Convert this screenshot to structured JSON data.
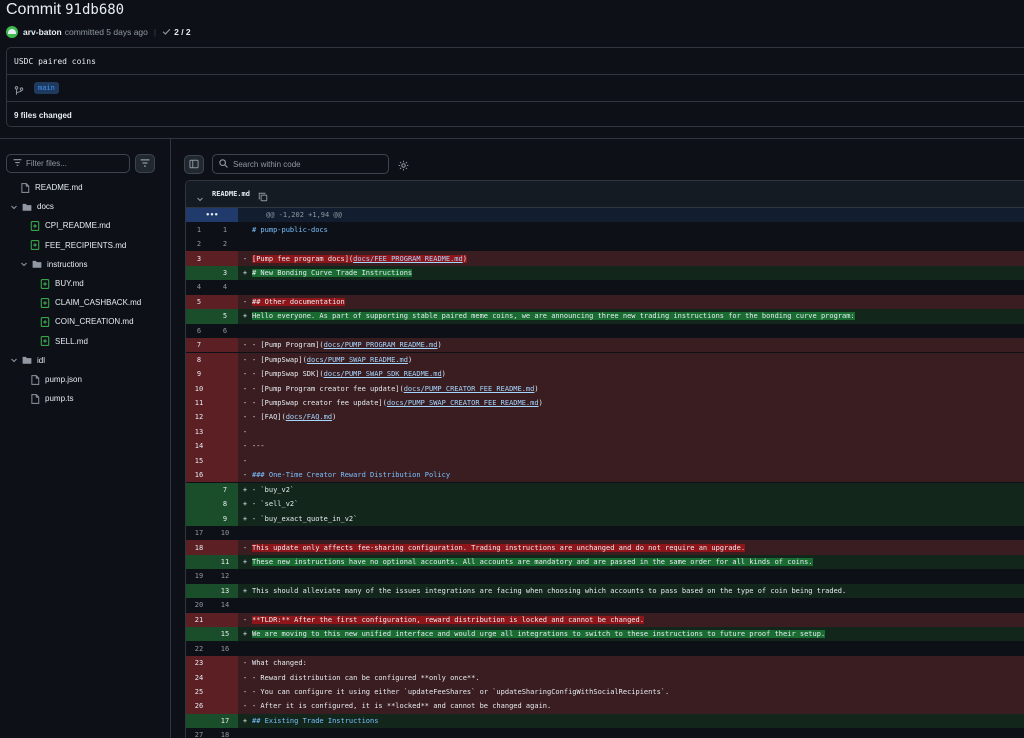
{
  "header": {
    "title_prefix": "Commit",
    "sha": "91db680",
    "author": "arv-baton",
    "committed_text": "committed 5 days ago",
    "checks": "2 / 2"
  },
  "commit": {
    "message": "USDC paired coins",
    "branch": "main",
    "files_changed": "9 files changed"
  },
  "filter": {
    "placeholder": "Filter files..."
  },
  "code_search": {
    "placeholder": "Search within code"
  },
  "tree": [
    {
      "label": "README.md",
      "type": "file",
      "depth": 0,
      "changed": false
    },
    {
      "label": "docs",
      "type": "folder",
      "depth": 0
    },
    {
      "label": "CPI_README.md",
      "type": "file",
      "depth": 1,
      "changed": true
    },
    {
      "label": "FEE_RECIPIENTS.md",
      "type": "file",
      "depth": 1,
      "changed": true
    },
    {
      "label": "instructions",
      "type": "folder",
      "depth": 1
    },
    {
      "label": "BUY.md",
      "type": "file",
      "depth": 2,
      "changed": true
    },
    {
      "label": "CLAIM_CASHBACK.md",
      "type": "file",
      "depth": 2,
      "changed": true
    },
    {
      "label": "COIN_CREATION.md",
      "type": "file",
      "depth": 2,
      "changed": true
    },
    {
      "label": "SELL.md",
      "type": "file",
      "depth": 2,
      "changed": true
    },
    {
      "label": "idl",
      "type": "folder",
      "depth": 0
    },
    {
      "label": "pump.json",
      "type": "file",
      "depth": 1,
      "changed": false
    },
    {
      "label": "pump.ts",
      "type": "file",
      "depth": 1,
      "changed": false
    }
  ],
  "diff": {
    "filename": "README.md",
    "hunk_expand": "•••",
    "lines": [
      {
        "t": "hunk",
        "o": "",
        "n": "",
        "text": "@@ -1,202 +1,94 @@"
      },
      {
        "t": "ctx",
        "o": "1",
        "n": "1",
        "text": "# pump-public-docs",
        "blue": true
      },
      {
        "t": "ctx",
        "o": "2",
        "n": "2",
        "text": ""
      },
      {
        "t": "del",
        "o": "3",
        "n": "",
        "text": "[Pump fee program docs](docs/FEE_PROGRAM_README.md)",
        "mark": true
      },
      {
        "t": "add",
        "o": "",
        "n": "3",
        "text": "# New Bonding Curve Trade Instructions",
        "mark": true
      },
      {
        "t": "ctx",
        "o": "4",
        "n": "4",
        "text": ""
      },
      {
        "t": "del",
        "o": "5",
        "n": "",
        "text": "## Other documentation",
        "mark": true
      },
      {
        "t": "add",
        "o": "",
        "n": "5",
        "text": "Hello everyone. As part of supporting stable paired meme coins, we are announcing three new trading instructions for the bonding curve program:",
        "mark": true
      },
      {
        "t": "ctx",
        "o": "6",
        "n": "6",
        "text": ""
      },
      {
        "t": "del",
        "o": "7",
        "n": "",
        "text": "- [Pump Program](docs/PUMP_PROGRAM_README.md)"
      },
      {
        "t": "del",
        "o": "8",
        "n": "",
        "text": "- [PumpSwap](docs/PUMP_SWAP_README.md)"
      },
      {
        "t": "del",
        "o": "9",
        "n": "",
        "text": "- [PumpSwap SDK](docs/PUMP_SWAP_SDK_README.md)"
      },
      {
        "t": "del",
        "o": "10",
        "n": "",
        "text": "- [Pump Program creator fee update](docs/PUMP_CREATOR_FEE_README.md)"
      },
      {
        "t": "del",
        "o": "11",
        "n": "",
        "text": "- [PumpSwap creator fee update](docs/PUMP_SWAP_CREATOR_FEE_README.md)"
      },
      {
        "t": "del",
        "o": "12",
        "n": "",
        "text": "- [FAQ](docs/FAQ.md)"
      },
      {
        "t": "del",
        "o": "13",
        "n": "",
        "text": ""
      },
      {
        "t": "del",
        "o": "14",
        "n": "",
        "text": "---"
      },
      {
        "t": "del",
        "o": "15",
        "n": "",
        "text": ""
      },
      {
        "t": "del",
        "o": "16",
        "n": "",
        "text": "### One-Time Creator Reward Distribution Policy",
        "blue": true
      },
      {
        "t": "add",
        "o": "",
        "n": "7",
        "text": "- `buy_v2`"
      },
      {
        "t": "add",
        "o": "",
        "n": "8",
        "text": "- `sell_v2`"
      },
      {
        "t": "add",
        "o": "",
        "n": "9",
        "text": "- `buy_exact_quote_in_v2`"
      },
      {
        "t": "ctx",
        "o": "17",
        "n": "10",
        "text": ""
      },
      {
        "t": "del",
        "o": "18",
        "n": "",
        "text": "This update only affects fee-sharing configuration. Trading instructions are unchanged and do not require an upgrade.",
        "mark": true
      },
      {
        "t": "add",
        "o": "",
        "n": "11",
        "text": "These new instructions have no optional accounts. All accounts are mandatory and are passed in the same order for all kinds of coins.",
        "mark": true
      },
      {
        "t": "ctx",
        "o": "19",
        "n": "12",
        "text": ""
      },
      {
        "t": "add",
        "o": "",
        "n": "13",
        "text": "This should alleviate many of the issues integrations are facing when choosing which accounts to pass based on the type of coin being traded."
      },
      {
        "t": "ctx",
        "o": "20",
        "n": "14",
        "text": ""
      },
      {
        "t": "del",
        "o": "21",
        "n": "",
        "text": "**TLDR:** After the first configuration, reward distribution is locked and cannot be changed.",
        "mark": true
      },
      {
        "t": "add",
        "o": "",
        "n": "15",
        "text": "We are moving to this new unified interface and would urge all integrations to switch to these instructions to future proof their setup.",
        "mark": true
      },
      {
        "t": "ctx",
        "o": "22",
        "n": "16",
        "text": ""
      },
      {
        "t": "del",
        "o": "23",
        "n": "",
        "text": "What changed:"
      },
      {
        "t": "del",
        "o": "24",
        "n": "",
        "text": "- Reward distribution can be configured **only once**."
      },
      {
        "t": "del",
        "o": "25",
        "n": "",
        "text": "- You can configure it using either `updateFeeShares` or `updateSharingConfigWithSocialRecipients`."
      },
      {
        "t": "del",
        "o": "26",
        "n": "",
        "text": "- After it is configured, it is **locked** and cannot be changed again."
      },
      {
        "t": "add",
        "o": "",
        "n": "17",
        "text": "## Existing Trade Instructions",
        "blue": true
      },
      {
        "t": "ctx",
        "o": "27",
        "n": "18",
        "text": ""
      }
    ]
  }
}
